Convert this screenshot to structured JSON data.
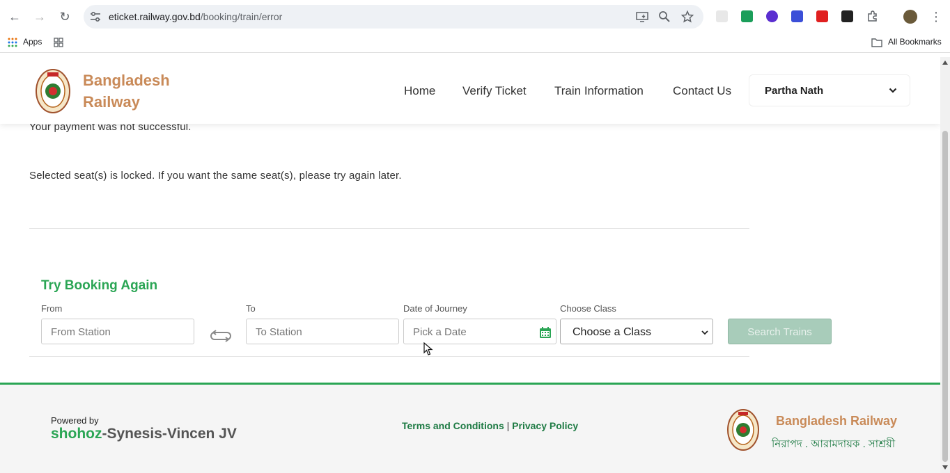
{
  "browser": {
    "url_host": "eticket.railway.gov.bd",
    "url_path": "/booking/train/error",
    "bookmarks": {
      "apps": "Apps",
      "all": "All Bookmarks"
    }
  },
  "header": {
    "brand_line1": "Bangladesh",
    "brand_line2": "Railway",
    "nav": [
      "Home",
      "Verify Ticket",
      "Train Information",
      "Contact Us"
    ],
    "user_name": "Partha Nath"
  },
  "message": {
    "payment_failed": "Your payment was not successful.",
    "seat_locked": "Selected seat(s) is locked. If you want the same seat(s), please try again later."
  },
  "booking": {
    "title": "Try Booking Again",
    "from_label": "From",
    "from_placeholder": "From Station",
    "to_label": "To",
    "to_placeholder": "To Station",
    "date_label": "Date of Journey",
    "date_placeholder": "Pick a Date",
    "class_label": "Choose Class",
    "class_value": "Choose a Class",
    "search_label": "Search Trains"
  },
  "footer": {
    "powered_by": "Powered by",
    "vendor_prefix": "shohoz",
    "vendor_suffix": "-Synesis-Vincen JV",
    "terms": "Terms and Conditions",
    "separator": "|",
    "privacy": "Privacy Policy",
    "brand": "Bangladesh Railway",
    "tagline": "নিরাপদ . আরামদায়ক . সাশ্রয়ী"
  },
  "colors": {
    "brand": "#c98a58",
    "green": "#2aa554",
    "dark_green": "#1d7a43",
    "search_disabled": "#a8ccba"
  }
}
